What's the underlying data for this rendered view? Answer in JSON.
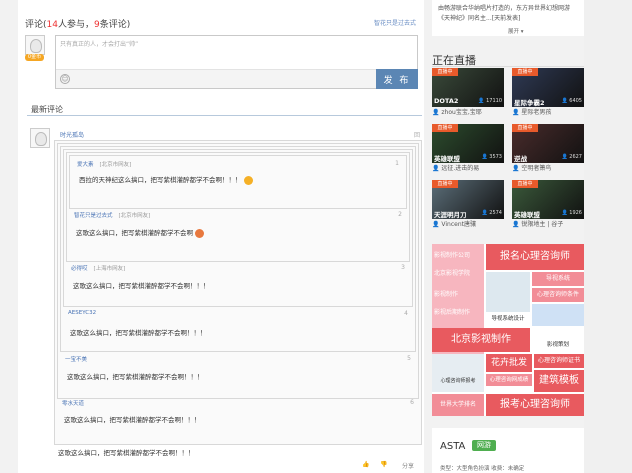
{
  "comment_box": {
    "title_prefix": "评论(",
    "participants": "14",
    "participants_suffix": "人参与，",
    "comment_count": "9",
    "comment_suffix": "条评论)",
    "option": "智花只是过去式",
    "badge": "0金币",
    "placeholder": "只有真正的人，才会打出“帅”",
    "post_button": "发 布"
  },
  "latest": {
    "title": "最新评论",
    "top_user": "时光孤岛",
    "top_right": "回"
  },
  "replies": [
    {
      "user": "爱大素",
      "location": "[北京市网友]",
      "num": "1",
      "text": "西拉的天神纪这么搞口，把写紫棋灌醉都学不会啊！！！",
      "emoji": "yes",
      "emoji_color": "#f5b026"
    },
    {
      "user": "智花只是过去式",
      "location": "[北京市网友]",
      "num": "2",
      "text": "这歌这么搞口，把写紫棋灌醉都学不会啊",
      "emoji": "yes",
      "emoji_color": "#e8783e"
    },
    {
      "user": "必得哎",
      "location": "[上海市网友]",
      "num": "3",
      "text": "这歌这么搞口，把写紫棋灌醉都学不会啊！！！",
      "emoji": "",
      "emoji_color": ""
    },
    {
      "user": "AESEYC32",
      "location": "",
      "num": "4",
      "text": "这歌这么搞口，把写紫棋灌醉都学不会啊！！！",
      "emoji": "",
      "emoji_color": ""
    },
    {
      "user": "一宝不美",
      "location": "",
      "num": "5",
      "text": "这歌这么搞口，把写紫棋灌醉都学不会啊！！！",
      "emoji": "",
      "emoji_color": ""
    },
    {
      "user": "零水天道",
      "location": "",
      "num": "6",
      "text": "这歌这么搞口，把写紫棋灌醉都学不会啊！！！",
      "emoji": "",
      "emoji_color": ""
    }
  ],
  "final_comment": {
    "text": "这歌这么搞口，把写紫棋灌醉都学不会啊！！！",
    "like": "👍",
    "dislike": "👎",
    "share": "分享"
  },
  "sidebar": {
    "top_note": "由畅游联合华纳唱片打造的，东方异世界幻想网游《天神纪》同名主...[天前发表]",
    "expand": "展开",
    "live_title": "正在直播",
    "live_tag": "直播中",
    "streams": [
      {
        "game": "DOTA2",
        "viewers": "17110",
        "host": "zhou宝宝,宝耶",
        "color": "#3a4a3a"
      },
      {
        "game": "星际争霸2",
        "viewers": "6405",
        "host": "星际老男孩",
        "color": "#2f3a55"
      },
      {
        "game": "英雄联盟",
        "viewers": "3573",
        "host": "远征.进击的易",
        "color": "#2d4d2e"
      },
      {
        "game": "逆战",
        "viewers": "2627",
        "host": "空明者箫鸟",
        "color": "#4a2c2c"
      },
      {
        "game": "天涯明月刀",
        "viewers": "2574",
        "host": "Vincent唐骧",
        "color": "#5c6f7a"
      },
      {
        "game": "英雄联盟",
        "viewers": "1926",
        "host": "锐限地主 | 谷子",
        "color": "#3b5a3b"
      }
    ],
    "ad": {
      "a1": "影视制作公司",
      "a2": "北京影视学院",
      "a3": "影视制作",
      "a4": "影视后期制作",
      "a5": "心理咨询师报考",
      "a6": "世界大学排名",
      "b1": "报名心理咨询师",
      "b2": "导视系统",
      "b3": "心理咨询师条件",
      "b4": "导视系统设计",
      "b5": "北京影视制作",
      "b6": "影视策划",
      "b7": "花卉批发",
      "b8": "心理咨询师证书",
      "b9": "建筑模板",
      "b10": "心理咨询网成绩",
      "b11": "报考心理咨询师"
    },
    "game_name": "ASTA",
    "game_tag": "网游",
    "game_meta": "类型：大型角色扮演   收费：未确定"
  }
}
